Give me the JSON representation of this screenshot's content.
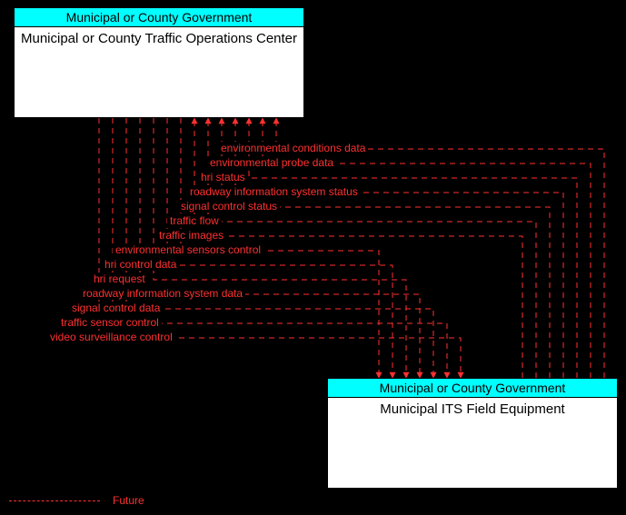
{
  "entities": {
    "top": {
      "owner": "Municipal or County Government",
      "title": "Municipal or County Traffic Operations Center"
    },
    "bottom": {
      "owner": "Municipal or County Government",
      "title": "Municipal ITS Field Equipment"
    }
  },
  "flows": [
    {
      "label": "environmental conditions data",
      "direction": "to_top",
      "status": "future"
    },
    {
      "label": "environmental probe data",
      "direction": "to_top",
      "status": "future"
    },
    {
      "label": "hri status",
      "direction": "to_top",
      "status": "future"
    },
    {
      "label": "roadway information system status",
      "direction": "to_top",
      "status": "future"
    },
    {
      "label": "signal control status",
      "direction": "to_top",
      "status": "future"
    },
    {
      "label": "traffic flow",
      "direction": "to_top",
      "status": "future"
    },
    {
      "label": "traffic images",
      "direction": "to_top",
      "status": "future"
    },
    {
      "label": "environmental sensors control",
      "direction": "to_bottom",
      "status": "future"
    },
    {
      "label": "hri control data",
      "direction": "to_bottom",
      "status": "future"
    },
    {
      "label": "hri request",
      "direction": "to_bottom",
      "status": "future"
    },
    {
      "label": "roadway information system data",
      "direction": "to_bottom",
      "status": "future"
    },
    {
      "label": "signal control data",
      "direction": "to_bottom",
      "status": "future"
    },
    {
      "label": "traffic sensor control",
      "direction": "to_bottom",
      "status": "future"
    },
    {
      "label": "video surveillance control",
      "direction": "to_bottom",
      "status": "future"
    }
  ],
  "legend": {
    "future": "Future"
  },
  "colors": {
    "background": "#000000",
    "header_bg": "#00ffff",
    "flow_line": "#ff3030",
    "box_bg": "#ffffff"
  }
}
